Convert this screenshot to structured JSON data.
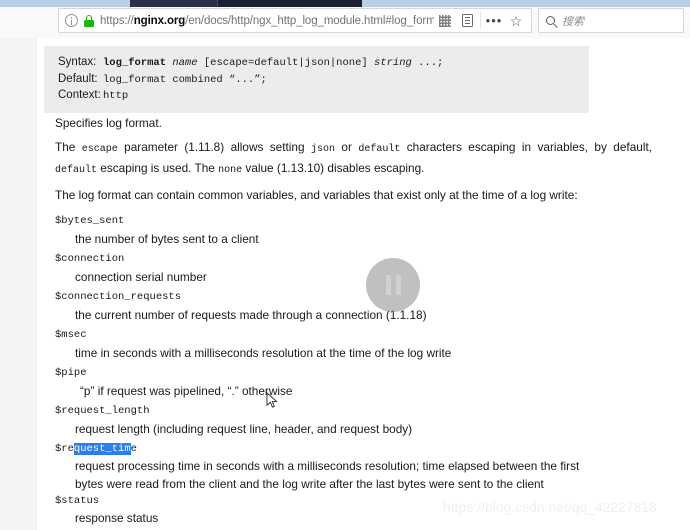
{
  "browser": {
    "url_scheme": "https://",
    "url_host": "nginx.org",
    "url_path": "/en/docs/http/ngx_http_log_module.html#log_format",
    "identity_icon": "info-icon",
    "lock_icon": "lock-icon",
    "qr_icon": "qr-code-icon",
    "reader_icon": "reader-view-icon",
    "page_actions_icon": "more-dots-icon",
    "bookmark_icon": "star-icon",
    "search": {
      "icon": "search-icon",
      "placeholder": "搜索"
    }
  },
  "doc": {
    "syntax_block": {
      "syntax_label": "Syntax:",
      "syntax_directive": "log_format",
      "syntax_name": "name",
      "syntax_escape": "[escape=default|json|none]",
      "syntax_string": "string",
      "syntax_tail": "...;",
      "default_label": "Default:",
      "default_value": "log_format combined “...”;",
      "context_label": "Context:",
      "context_value": "http"
    },
    "p1": "Specifies log format.",
    "p2_a": "The ",
    "p2_escape": "escape",
    "p2_b": " parameter (1.11.8) allows setting ",
    "p2_json": "json",
    "p2_c": " or ",
    "p2_default": "default",
    "p2_d": " characters escaping in variables, by default, ",
    "p2_default2": "default",
    "p2_e": " escaping is used. The ",
    "p2_none": "none",
    "p2_f": " value (1.13.10) disables escaping.",
    "p3": "The log format can contain common variables, and variables that exist only at the time of a log write:",
    "variables": [
      {
        "name": "$bytes_sent",
        "desc": "the number of bytes sent to a client"
      },
      {
        "name": "$connection",
        "desc": "connection serial number"
      },
      {
        "name": "$connection_requests",
        "desc": "the current number of requests made through a connection (1.1.18)"
      },
      {
        "name": "$msec",
        "desc": "time in seconds with a milliseconds resolution at the time of the log write"
      },
      {
        "name": "$pipe",
        "desc": "“p” if request was pipelined, “.” otherwise"
      },
      {
        "name": "$request_length",
        "desc": "request length (including request line, header, and request body)"
      },
      {
        "name": "$request_time",
        "name_prefix": "$re",
        "name_selected": "quest_tim",
        "name_suffix": "e",
        "desc_line1": "request processing time in seconds with a milliseconds resolution; time elapsed between the first",
        "desc_line2": "bytes were read from the client and the log write after the last bytes were sent to the client"
      },
      {
        "name": "$status",
        "desc": "response status"
      }
    ]
  },
  "overlay": {
    "media_control": "pause-icon",
    "cursor": "mouse-pointer"
  },
  "watermark": "https://blog.csdn.net/qq_42227818",
  "colors": {
    "selection_blue": "#2a7fed",
    "lock_green": "#12bc00",
    "code_bg": "#ececec",
    "chrome_bg": "#f9f9fa",
    "tab_dark": "#1c2033",
    "tab_light": "#b9cfe7"
  }
}
